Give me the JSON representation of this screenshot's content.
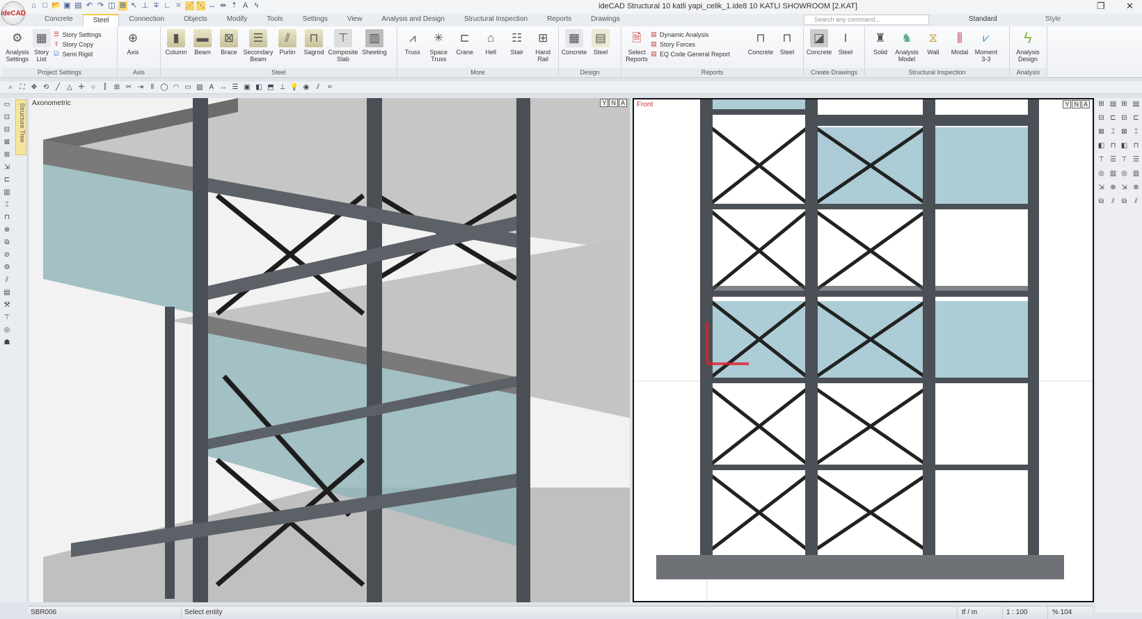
{
  "app": {
    "logo": "ideCAD",
    "title": "ideCAD Structural  10 katli yapi_celik_1.ide8  10 KATLI SHOWROOM  [2.KAT]"
  },
  "window": {
    "restore": "❐",
    "close": "✕"
  },
  "tabs": [
    "Concrete",
    "Steel",
    "Connection",
    "Objects",
    "Modify",
    "Tools",
    "Settings",
    "View",
    "Analysis and Design",
    "Structural Inspection",
    "Reports",
    "Drawings"
  ],
  "search": {
    "placeholder": "Search any command..."
  },
  "style": {
    "selected": "Standard",
    "label": "Style"
  },
  "ribbon": {
    "project_settings": {
      "label": "Project Settings",
      "analysis_settings": "Analysis Settings",
      "story_list": "Story List",
      "story_settings": "Story Settings",
      "story_copy": "Story Copy",
      "semi_rigid": "Semi Rigid"
    },
    "axis": {
      "label": "Axis",
      "axis": "Axis"
    },
    "steel": {
      "label": "Steel",
      "items": [
        "Column",
        "Beam",
        "Brace",
        "Secondary Beam",
        "Purlin",
        "Sagrod",
        "Composite Slab",
        "Sheeting"
      ]
    },
    "more": {
      "label": "More",
      "items": [
        "Truss",
        "Space Truss",
        "Crane",
        "Hell",
        "Stair",
        "Hand Rail"
      ]
    },
    "design": {
      "label": "Design",
      "items": [
        "Concrete",
        "Steel"
      ]
    },
    "reports": {
      "label": "Reports",
      "select": "Select Reports",
      "dynamic": "Dynamic Analysis",
      "story_forces": "Story Forces",
      "eq_code": "EQ Code General Report",
      "items": [
        "Concrete",
        "Steel"
      ]
    },
    "create_drawings": {
      "label": "Create Drawings",
      "items": [
        "Concrete",
        "Steel"
      ]
    },
    "structural_inspection": {
      "label": "Structural Inspection",
      "items": [
        "Solid",
        "Analysis Model",
        "Wall",
        "Modal",
        "Moment 3-3"
      ]
    },
    "analysis": {
      "label": "Analysis",
      "items": [
        "Analysis Design"
      ]
    }
  },
  "left_panel": {
    "tree_tab": "Structure Tree"
  },
  "viewports": {
    "left": {
      "label": "Axonometric"
    },
    "right": {
      "label": "Front"
    },
    "controls": [
      "Y",
      "N",
      "A"
    ]
  },
  "status": {
    "code": "SBR006",
    "message": "Select entity",
    "units": "tf / m",
    "scale": "1 : 100",
    "zoom": "% 104"
  }
}
